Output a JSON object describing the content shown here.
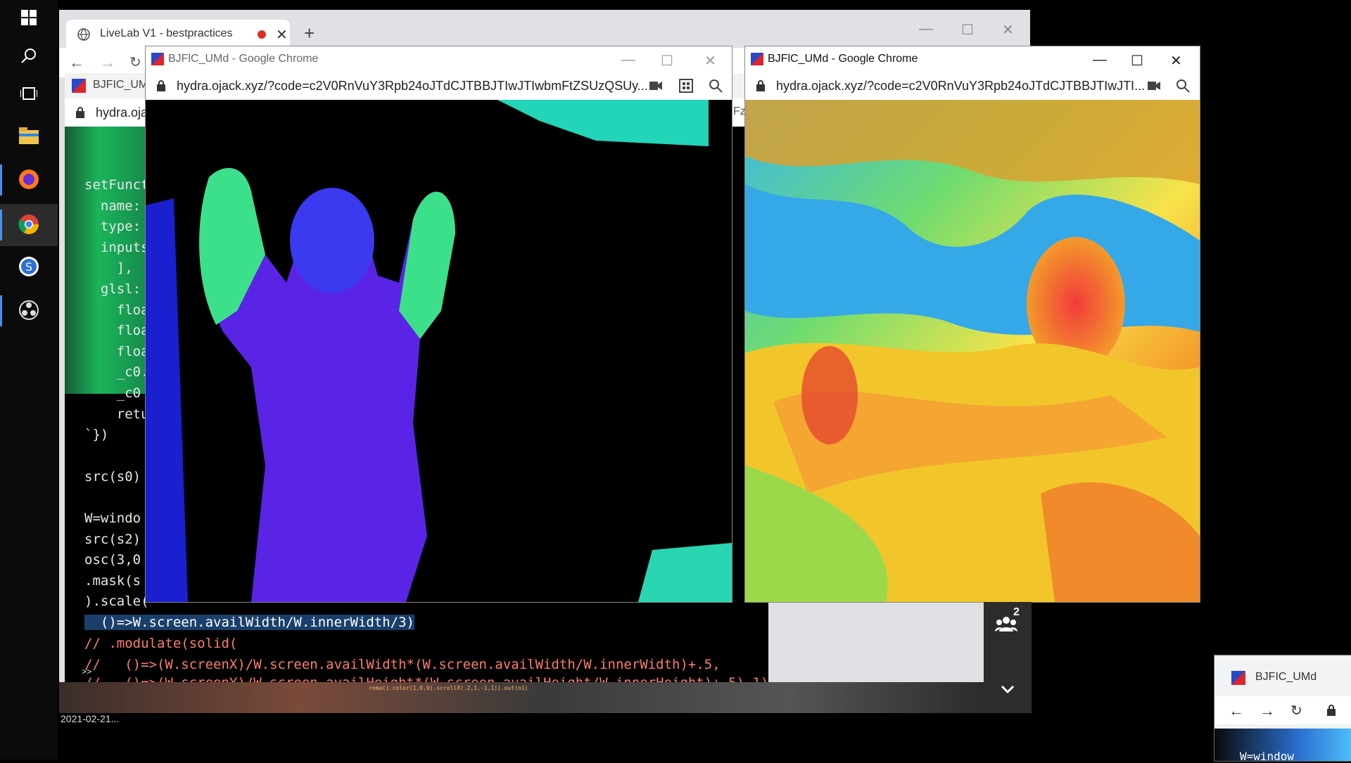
{
  "taskbar": {
    "items": [
      {
        "name": "windows-start-icon"
      },
      {
        "name": "search-icon"
      },
      {
        "name": "task-view-icon"
      },
      {
        "name": "file-explorer-icon"
      },
      {
        "name": "firefox-icon"
      },
      {
        "name": "chrome-icon"
      },
      {
        "name": "app-s-icon"
      },
      {
        "name": "obs-icon"
      }
    ]
  },
  "livelab_window": {
    "tab_title": "LiveLab V1 - bestpractices",
    "new_tab_glyph": "+"
  },
  "code_window": {
    "title": "BJFIC_UMd",
    "url": "hydra.oja",
    "code_lines": [
      "setFunct",
      "  name: ",
      "  type: ",
      "  inputs",
      "    ],",
      "  glsl: ",
      "    float",
      "    float",
      "    float",
      "    _c0.g",
      "    _c0 ",
      "    retur",
      "`})",
      "",
      "src(s0)",
      "",
      "W=windo",
      "src(s2)",
      "osc(3,0",
      ".mask(s",
      ").scale(",
      "  ()=>W.screen.availWidth/W.innerWidth/3)",
      "// .modulate(solid(",
      "//   ()=>(W.screenX)/W.screen.availWidth*(W.screen.availWidth/W.innerWidth)+.5,",
      "//   ()=>(W.screenY)/W.screen.availHeight*(W.screen.availHeight/W.innerHeight)+.5),1)"
    ],
    "prompt_glyph": ">>"
  },
  "chrome_window_1": {
    "title": "BJFlC_UMd - Google Chrome",
    "url": "hydra.ojack.xyz/?code=c2V0RnVuY3Rpb24oJTdCJTBBJTIwJTIwbmFtZSUzQSUy...",
    "side_snippet": "Fz"
  },
  "chrome_window_2": {
    "title": "BJFlC_UMd - Google Chrome",
    "url": "hydra.ojack.xyz/?code=c2V0RnVuY3Rpb24oJTdCJTBBJTIwJTI..."
  },
  "meeting_panel": {
    "participant_count": "2"
  },
  "bottom_strip": {
    "timestamp": "2021-02-21...",
    "tiny_code": "roma().color(1,0,0).scrollX(.2,1,-1,1)).out(o1)"
  },
  "bottom_right_window": {
    "title": "BJFIC_UMd",
    "code_snippet": "W=window"
  },
  "colors": {
    "taskbar_bg": "#0b0b0b",
    "chrome_active_accent": "#4a90e2",
    "record_dot": "#d93025",
    "comment_text": "#ff7c6c"
  }
}
